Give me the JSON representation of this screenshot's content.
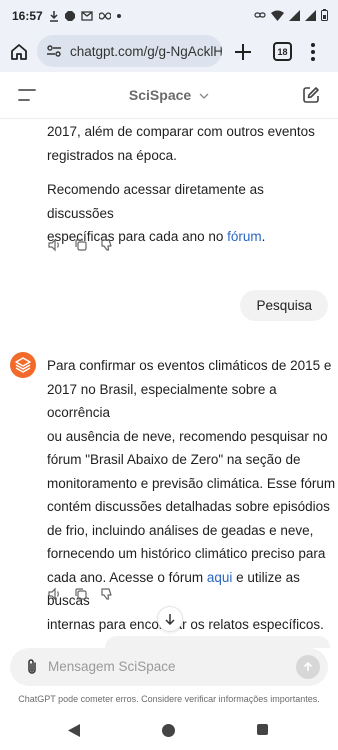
{
  "status_bar": {
    "time": "16:57",
    "icons_left": [
      "download-icon",
      "stop-icon",
      "gmail-icon",
      "infinity-icon",
      "dot-icon"
    ],
    "icons_right": [
      "link-icon",
      "wifi-icon",
      "signal-icon",
      "signal-icon",
      "battery-icon"
    ]
  },
  "browser": {
    "url": "chatgpt.com/g/g-NgAcklHd",
    "tab_count": "18"
  },
  "app": {
    "title": "SciSpace"
  },
  "messages": [
    {
      "role": "assistant",
      "paragraphs": [
        [
          "2017, além de comparar com outros eventos",
          "registrados na época."
        ],
        [
          "Recomendo acessar diretamente as discussões",
          "específicas para cada ano no "
        ]
      ],
      "link_text": "fórum",
      "link_suffix": "."
    },
    {
      "role": "user",
      "text": "Pesquisa"
    },
    {
      "role": "assistant",
      "lines": [
        "Para confirmar os eventos climáticos de 2015 e",
        "2017 no Brasil, especialmente sobre a ocorrência",
        "ou ausência de neve, recomendo pesquisar no",
        "fórum \"Brasil Abaixo de Zero\" na seção de",
        "monitoramento e previsão climática. Esse fórum",
        "contém discussões detalhadas sobre episódios",
        "de frio, incluindo análises de geadas e neve,",
        "fornecendo um histórico climático preciso para",
        "cada ano. Acesse o fórum "
      ],
      "link_text": "aqui",
      "link_suffix": " e utilize as buscas",
      "last_line": "internas para encontrar os relatos específicos."
    }
  ],
  "composer": {
    "placeholder": "Mensagem SciSpace"
  },
  "disclaimer": "ChatGPT pode cometer erros. Considere verificar informações importantes.",
  "colors": {
    "accent_link": "#2b66c4",
    "avatar": "#f26b2a",
    "browser_bar": "#eef1f8"
  }
}
